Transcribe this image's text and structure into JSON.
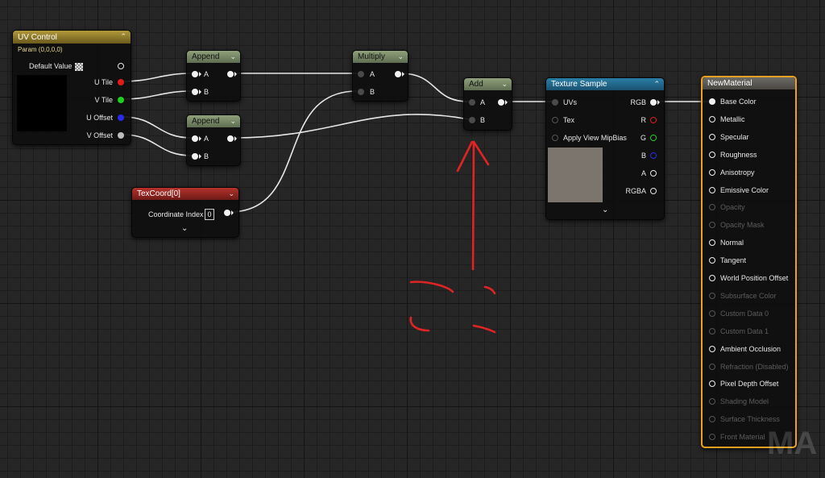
{
  "nodes": {
    "uv_control": {
      "title": "UV Control",
      "subtitle": "Param (0,0,0,0)",
      "default_label": "Default Value",
      "outputs": [
        "U Tile",
        "V Tile",
        "U Offset",
        "V Offset"
      ]
    },
    "append_1": {
      "title": "Append",
      "inputs": [
        "A",
        "B"
      ]
    },
    "append_2": {
      "title": "Append",
      "inputs": [
        "A",
        "B"
      ]
    },
    "multiply": {
      "title": "Multiply",
      "inputs": [
        "A",
        "B"
      ]
    },
    "add": {
      "title": "Add",
      "inputs": [
        "A",
        "B"
      ]
    },
    "texcoord": {
      "title": "TexCoord[0]",
      "coord_label": "Coordinate Index",
      "coord_value": "0"
    },
    "texture_sample": {
      "title": "Texture Sample",
      "inputs": [
        "UVs",
        "Tex",
        "Apply View MipBias"
      ],
      "outputs": [
        "RGB",
        "R",
        "G",
        "B",
        "A",
        "RGBA"
      ]
    },
    "new_material": {
      "title": "NewMaterial",
      "pins": [
        {
          "label": "Base Color",
          "active": true
        },
        {
          "label": "Metallic",
          "active": true
        },
        {
          "label": "Specular",
          "active": true
        },
        {
          "label": "Roughness",
          "active": true
        },
        {
          "label": "Anisotropy",
          "active": true
        },
        {
          "label": "Emissive Color",
          "active": true
        },
        {
          "label": "Opacity",
          "active": false
        },
        {
          "label": "Opacity Mask",
          "active": false
        },
        {
          "label": "Normal",
          "active": true
        },
        {
          "label": "Tangent",
          "active": true
        },
        {
          "label": "World Position Offset",
          "active": true
        },
        {
          "label": "Subsurface Color",
          "active": false
        },
        {
          "label": "Custom Data 0",
          "active": false
        },
        {
          "label": "Custom Data 1",
          "active": false
        },
        {
          "label": "Ambient Occlusion",
          "active": true
        },
        {
          "label": "Refraction (Disabled)",
          "active": false
        },
        {
          "label": "Pixel Depth Offset",
          "active": true
        },
        {
          "label": "Shading Model",
          "active": false
        },
        {
          "label": "Surface Thickness",
          "active": false
        },
        {
          "label": "Front Material",
          "active": false
        }
      ]
    }
  },
  "pin_colors": {
    "u_tile": "#e01c1c",
    "v_tile": "#1fd11f",
    "u_offset": "#2a2ae8",
    "v_offset": "#bdbdbd",
    "r": "#e01c1c",
    "g": "#1fd11f",
    "b": "#2a2ae8"
  },
  "texture_preview_color": "#7b756d",
  "material_border_color": "#f0a020",
  "annotation_color": "#e02424",
  "watermark": "MA"
}
